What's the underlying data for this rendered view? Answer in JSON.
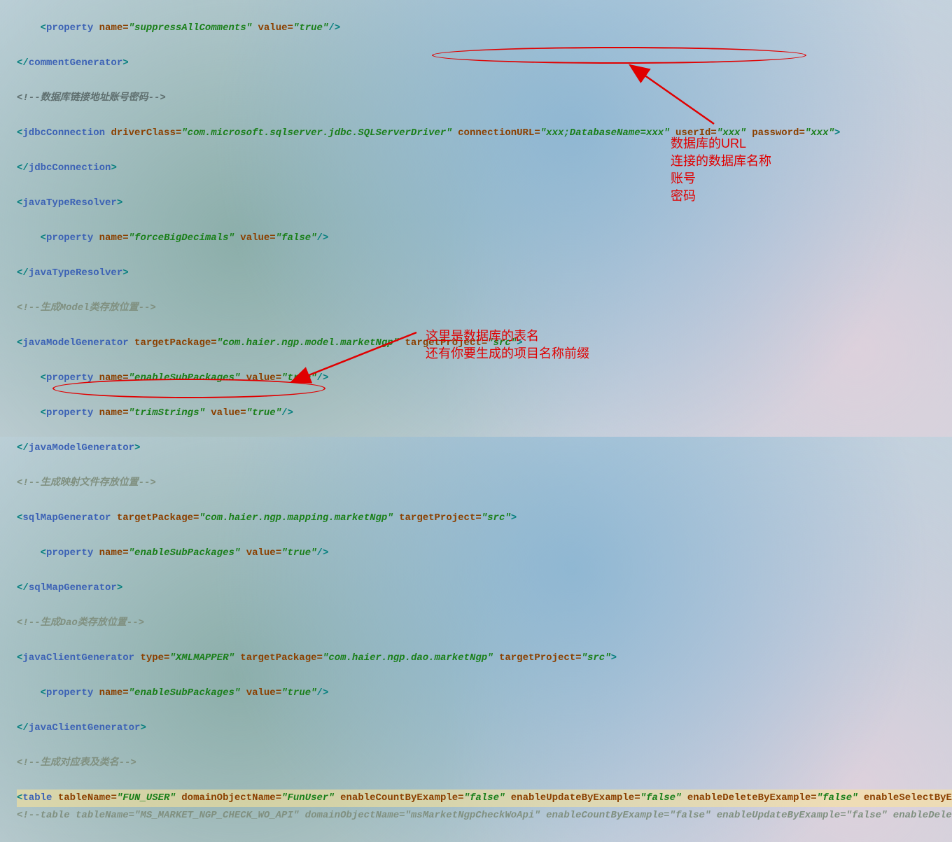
{
  "lines": {
    "l1": {
      "attr1": "name=",
      "val1": "\"suppressAllComments\"",
      "attr2": "value=",
      "val2": "\"true\""
    },
    "l2": {
      "tag": "commentGenerator"
    },
    "l3": {
      "comment": "<!--数据库链接地址账号密码-->"
    },
    "l4": {
      "tag": "jdbcConnection",
      "a1": "driverClass=",
      "v1": "\"com.microsoft.sqlserver.jdbc.SQLServerDriver\"",
      "a2": "connectionURL=",
      "v2": "\"xxx;DatabaseName=xxx\"",
      "a3": "userId=",
      "v3": "\"xxx\"",
      "a4": "password=",
      "v4": "\"xxx\""
    },
    "l5": {
      "tag": "jdbcConnection"
    },
    "l6": {
      "tag": "javaTypeResolver"
    },
    "l7": {
      "attr1": "name=",
      "val1": "\"forceBigDecimals\"",
      "attr2": "value=",
      "val2": "\"false\""
    },
    "l8": {
      "tag": "javaTypeResolver"
    },
    "l9": {
      "comment": "<!--生成Model类存放位置-->"
    },
    "l10": {
      "tag": "javaModelGenerator",
      "a1": "targetPackage=",
      "v1": "\"com.haier.ngp.model.marketNgp\"",
      "a2": "targetProject=",
      "v2": "\"src\""
    },
    "l11": {
      "attr1": "name=",
      "val1": "\"enableSubPackages\"",
      "attr2": "value=",
      "val2": "\"true\""
    },
    "l12": {
      "attr1": "name=",
      "val1": "\"trimStrings\"",
      "attr2": "value=",
      "val2": "\"true\""
    },
    "l13": {
      "tag": "javaModelGenerator"
    },
    "l14": {
      "comment": "<!--生成映射文件存放位置-->"
    },
    "l15": {
      "tag": "sqlMapGenerator",
      "a1": "targetPackage=",
      "v1": "\"com.haier.ngp.mapping.marketNgp\"",
      "a2": "targetProject=",
      "v2": "\"src\""
    },
    "l16": {
      "attr1": "name=",
      "val1": "\"enableSubPackages\"",
      "attr2": "value=",
      "val2": "\"true\""
    },
    "l17": {
      "tag": "sqlMapGenerator"
    },
    "l18": {
      "comment": "<!--生成Dao类存放位置-->"
    },
    "l19": {
      "tag": "javaClientGenerator",
      "a0": "type=",
      "v0": "\"XMLMAPPER\"",
      "a1": "targetPackage=",
      "v1": "\"com.haier.ngp.dao.marketNgp\"",
      "a2": "targetProject=",
      "v2": "\"src\""
    },
    "l20": {
      "attr1": "name=",
      "val1": "\"enableSubPackages\"",
      "attr2": "value=",
      "val2": "\"true\""
    },
    "l21": {
      "tag": "javaClientGenerator"
    },
    "l22": {
      "comment": "<!--生成对应表及类名-->"
    },
    "l23": {
      "tag": "table",
      "a1": "tableName=",
      "v1": "\"FUN_USER\"",
      "a2": "domainObjectName=",
      "v2": "\"FunUser\"",
      "a3": "enableCountByExample=",
      "v3": "\"false\"",
      "a4": "enableUpdateByExample=",
      "v4": "\"false\"",
      "a5": "enableDeleteByExample=",
      "v5": "\"false\"",
      "a6": "enableSelectByExample=",
      "v6": "\""
    },
    "l24": {
      "comment": "<!--table tableName=\"MS_MARKET_NGP_CHECK_WO_API\" domainObjectName=\"msMarketNgpCheckWoApi\" enableCountByExample=\"false\" enableUpdateByExample=\"false\" enableDeleteByExa"
    }
  },
  "annotation1": {
    "l1": "数据库的URL",
    "l2": "连接的数据库名称",
    "l3": "账号",
    "l4": "密码"
  },
  "annotation2": {
    "l1": "这里是数据库的表名",
    "l2": "还有你要生成的项目名称前缀"
  }
}
